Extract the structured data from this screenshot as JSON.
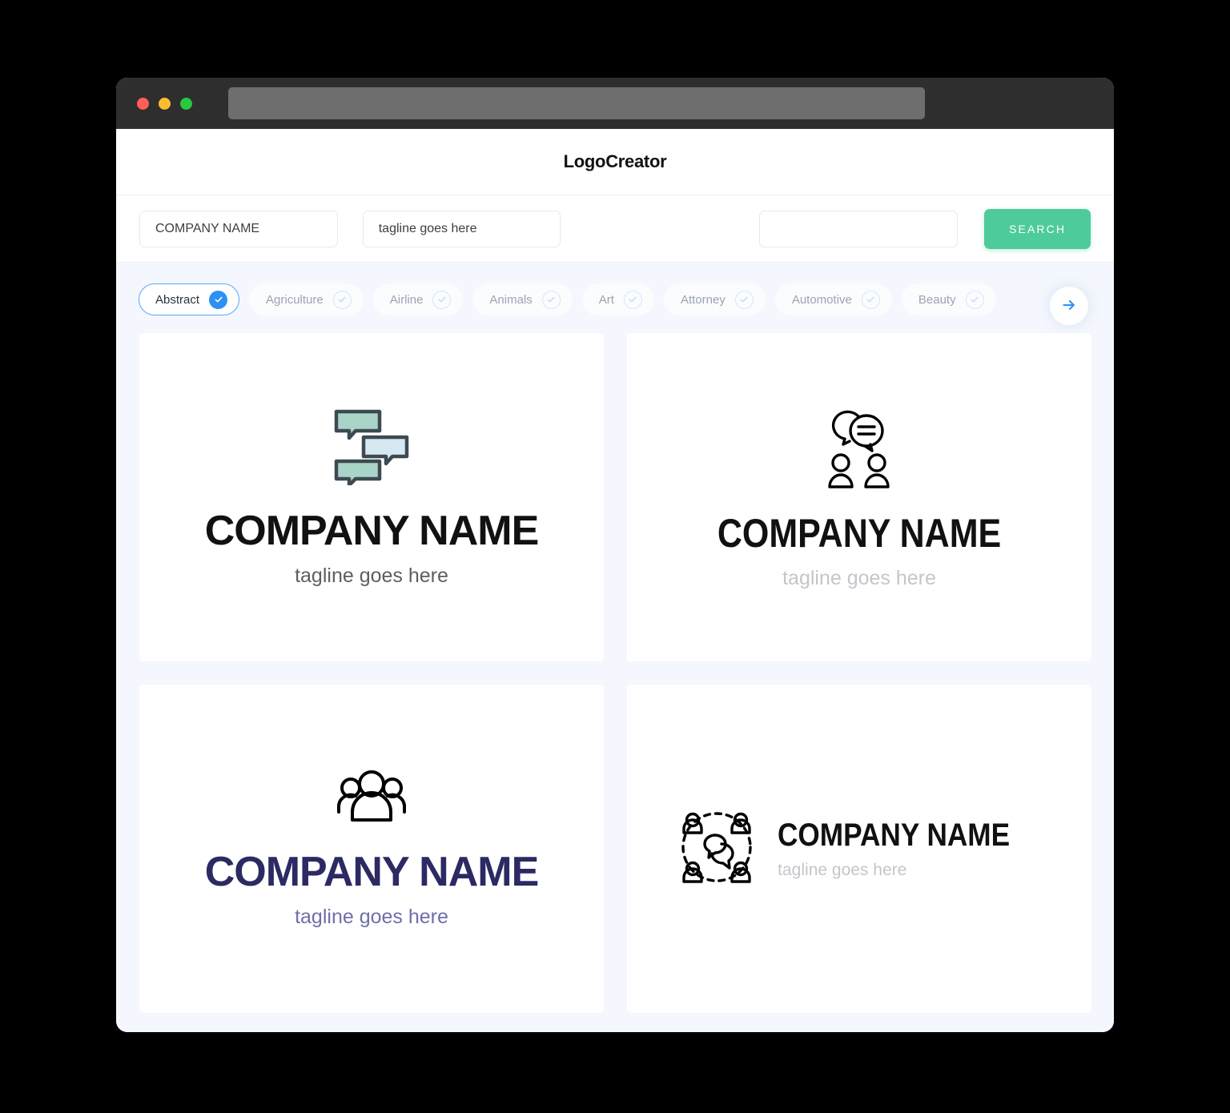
{
  "window": {
    "traffic_lights": [
      "close",
      "minimize",
      "maximize"
    ],
    "colors": {
      "close": "#ff5f57",
      "minimize": "#febc2e",
      "maximize": "#28c840"
    },
    "url_value": ""
  },
  "header": {
    "title": "LogoCreator"
  },
  "search": {
    "company_value": "COMPANY NAME",
    "company_placeholder": "COMPANY NAME",
    "tagline_value": "tagline goes here",
    "tagline_placeholder": "tagline goes here",
    "extra_value": "",
    "extra_placeholder": "",
    "button_label": "SEARCH",
    "button_color": "#4ecb9b"
  },
  "categories": {
    "accent_color": "#2e90f5",
    "next_icon": "arrow-right-icon",
    "items": [
      {
        "label": "Abstract",
        "selected": true
      },
      {
        "label": "Agriculture",
        "selected": false
      },
      {
        "label": "Airline",
        "selected": false
      },
      {
        "label": "Animals",
        "selected": false
      },
      {
        "label": "Art",
        "selected": false
      },
      {
        "label": "Attorney",
        "selected": false
      },
      {
        "label": "Automotive",
        "selected": false
      },
      {
        "label": "Beauty",
        "selected": false
      }
    ]
  },
  "logos": [
    {
      "icon": "three-speech-bubbles-icon",
      "name": "COMPANY NAME",
      "tagline": "tagline goes here",
      "name_color": "#111111",
      "tagline_color": "#5b5f63",
      "icon_colors": {
        "green": "#a8d5c8",
        "blue": "#d6e8f2",
        "outline": "#3e4a52"
      }
    },
    {
      "icon": "two-bubbles-two-people-icon",
      "name": "COMPANY NAME",
      "tagline": "tagline goes here",
      "name_color": "#111111",
      "tagline_color": "#c3c6ca",
      "icon_colors": {
        "outline": "#000000"
      }
    },
    {
      "icon": "group-of-three-people-icon",
      "name": "COMPANY NAME",
      "tagline": "tagline goes here",
      "name_color": "#2b2a63",
      "tagline_color": "#6e6fa8",
      "icon_colors": {
        "outline": "#000000"
      }
    },
    {
      "icon": "four-people-circle-bubbles-icon",
      "name": "COMPANY NAME",
      "tagline": "tagline goes here",
      "name_color": "#111111",
      "tagline_color": "#c3c6ca",
      "icon_colors": {
        "outline": "#000000"
      }
    }
  ]
}
